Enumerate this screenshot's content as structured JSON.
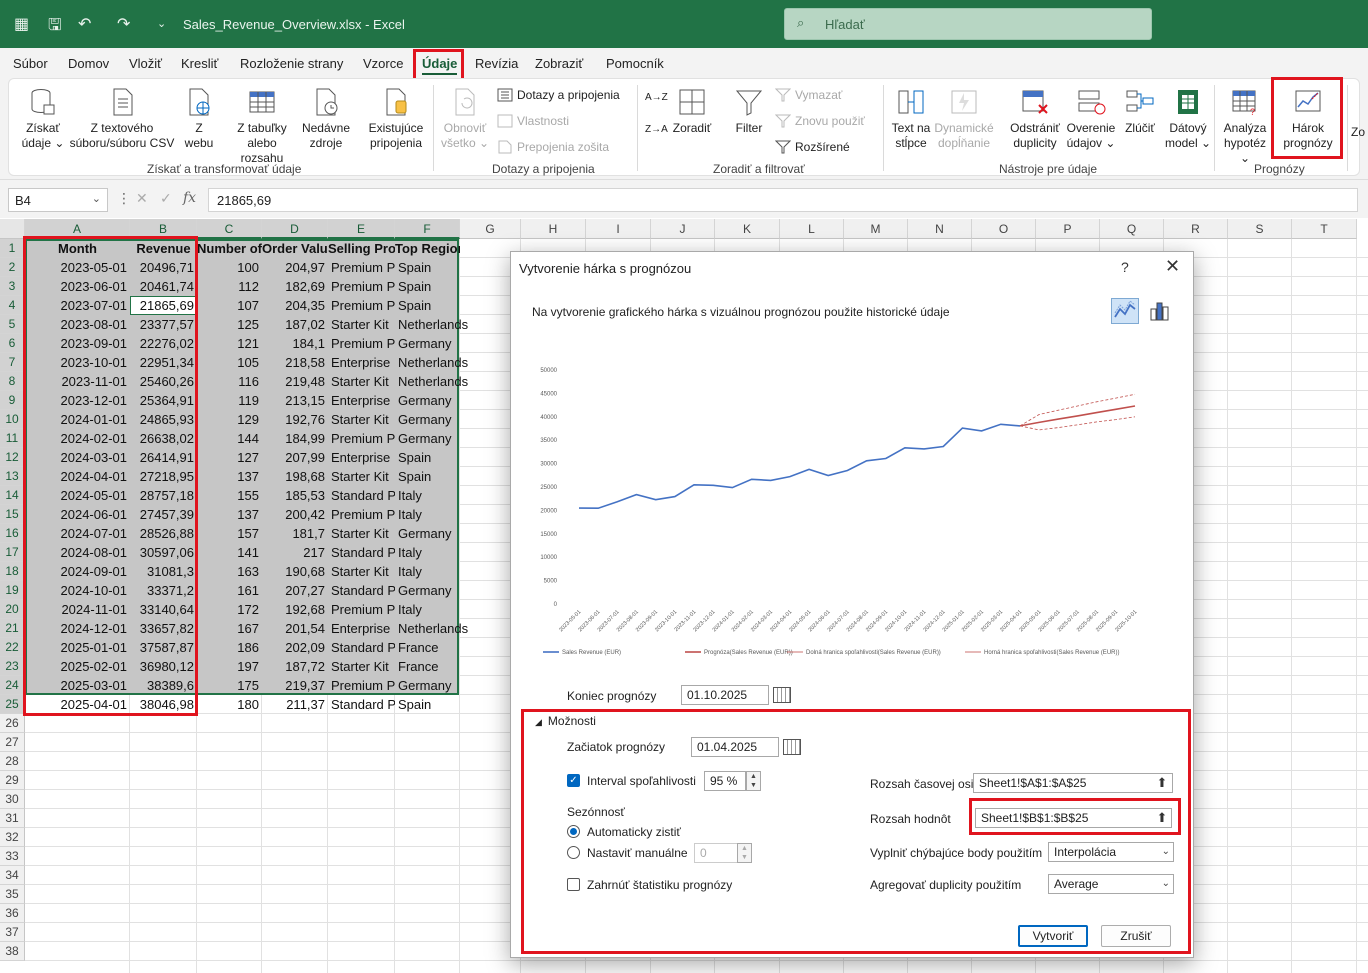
{
  "window": {
    "filename": "Sales_Revenue_Overview.xlsx",
    "separator": " - ",
    "app": "Excel",
    "search_placeholder": "Hľadať",
    "icons": [
      "excel-logo-icon",
      "save-icon",
      "undo-icon",
      "redo-icon",
      "customize-icon",
      "search-icon"
    ]
  },
  "menu": [
    "Súbor",
    "Domov",
    "Vložiť",
    "Kresliť",
    "Rozloženie strany",
    "Vzorce",
    "Údaje",
    "Revízia",
    "Zobraziť",
    "Pomocník"
  ],
  "ribbon": {
    "get_data": {
      "l1": "Získať",
      "l2": "údaje ⌄"
    },
    "text_csv": {
      "l1": "Z textového",
      "l2": "súboru/súboru CSV"
    },
    "web": {
      "l1": "Z",
      "l2": "webu"
    },
    "table_range": {
      "l1": "Z tabuľky",
      "l2": "alebo rozsahu"
    },
    "recent": {
      "l1": "Nedávne",
      "l2": "zdroje"
    },
    "existing": {
      "l1": "Existujúce",
      "l2": "pripojenia"
    },
    "group1": "Získať a transformovať údaje",
    "refresh": {
      "l1": "Obnoviť",
      "l2": "všetko ⌄"
    },
    "queries": "Dotazy a pripojenia",
    "properties": "Vlastnosti",
    "edit_links": "Prepojenia zošita",
    "group2": "Dotazy a pripojenia",
    "sort_az": "A→Z",
    "sort_za": "Z→A",
    "sort": "Zoradiť",
    "filter": "Filter",
    "clear": "Vymazať",
    "reapply": "Znovu použiť",
    "advanced": "Rozšírené",
    "group3": "Zoradiť a filtrovať",
    "text_columns": {
      "l1": "Text na",
      "l2": "stĺpce"
    },
    "flash_fill": {
      "l1": "Dynamické",
      "l2": "dopĺňanie"
    },
    "remove_dup": {
      "l1": "Odstrániť",
      "l2": "duplicity"
    },
    "validation": {
      "l1": "Overenie",
      "l2": "údajov ⌄"
    },
    "consolidate": {
      "l1": "Zlúčiť",
      "l2": ""
    },
    "data_model": {
      "l1": "Dátový",
      "l2": "model ⌄"
    },
    "group4": "Nástroje pre údaje",
    "whatif": {
      "l1": "Analýza",
      "l2": "hypotéz ⌄"
    },
    "forecast_sheet": {
      "l1": "Hárok",
      "l2": "prognózy"
    },
    "group5": "Prognózy",
    "cut_label": "Zo"
  },
  "formula": {
    "namebox": "B4",
    "namebox_arrow": "⌄",
    "more": "⋮",
    "cancel": "✕",
    "enter": "✓",
    "fx": "fx",
    "value": "21865,69"
  },
  "columns": [
    "A",
    "B",
    "C",
    "D",
    "E",
    "F",
    "G",
    "H",
    "I",
    "J",
    "K",
    "L",
    "M",
    "N",
    "O",
    "P",
    "Q",
    "R",
    "S",
    "T"
  ],
  "headers": [
    "Month",
    "Revenue",
    "Number of Orders",
    "Order Value",
    "Selling Product",
    "Top Region"
  ],
  "rows": [
    [
      "2023-05-01",
      "20496,71",
      "100",
      "204,97",
      "Premium P",
      "Spain"
    ],
    [
      "2023-06-01",
      "20461,74",
      "112",
      "182,69",
      "Premium P",
      "Spain"
    ],
    [
      "2023-07-01",
      "21865,69",
      "107",
      "204,35",
      "Premium P",
      "Spain"
    ],
    [
      "2023-08-01",
      "23377,57",
      "125",
      "187,02",
      "Starter Kit",
      "Netherlands"
    ],
    [
      "2023-09-01",
      "22276,02",
      "121",
      "184,1",
      "Premium P",
      "Germany"
    ],
    [
      "2023-10-01",
      "22951,34",
      "105",
      "218,58",
      "Enterprise",
      "Netherlands"
    ],
    [
      "2023-11-01",
      "25460,26",
      "116",
      "219,48",
      "Starter Kit",
      "Netherlands"
    ],
    [
      "2023-12-01",
      "25364,91",
      "119",
      "213,15",
      "Enterprise",
      "Germany"
    ],
    [
      "2024-01-01",
      "24865,93",
      "129",
      "192,76",
      "Starter Kit",
      "Germany"
    ],
    [
      "2024-02-01",
      "26638,02",
      "144",
      "184,99",
      "Premium P",
      "Germany"
    ],
    [
      "2024-03-01",
      "26414,91",
      "127",
      "207,99",
      "Enterprise",
      "Spain"
    ],
    [
      "2024-04-01",
      "27218,95",
      "137",
      "198,68",
      "Starter Kit",
      "Spain"
    ],
    [
      "2024-05-01",
      "28757,18",
      "155",
      "185,53",
      "Standard P",
      "Italy"
    ],
    [
      "2024-06-01",
      "27457,39",
      "137",
      "200,42",
      "Premium P",
      "Italy"
    ],
    [
      "2024-07-01",
      "28526,88",
      "157",
      "181,7",
      "Starter Kit",
      "Germany"
    ],
    [
      "2024-08-01",
      "30597,06",
      "141",
      "217",
      "Standard P",
      "Italy"
    ],
    [
      "2024-09-01",
      "31081,3",
      "163",
      "190,68",
      "Starter Kit",
      "Italy"
    ],
    [
      "2024-10-01",
      "33371,2",
      "161",
      "207,27",
      "Standard P",
      "Germany"
    ],
    [
      "2024-11-01",
      "33140,64",
      "172",
      "192,68",
      "Premium P",
      "Italy"
    ],
    [
      "2024-12-01",
      "33657,82",
      "167",
      "201,54",
      "Enterprise",
      "Netherlands"
    ],
    [
      "2025-01-01",
      "37587,87",
      "186",
      "202,09",
      "Standard P",
      "France"
    ],
    [
      "2025-02-01",
      "36980,12",
      "197",
      "187,72",
      "Starter Kit",
      "France"
    ],
    [
      "2025-03-01",
      "38389,6",
      "175",
      "219,37",
      "Premium P",
      "Germany"
    ],
    [
      "2025-04-01",
      "38046,98",
      "180",
      "211,37",
      "Standard P",
      "Spain"
    ]
  ],
  "row_numbers": [
    "1",
    "2",
    "3",
    "4",
    "5",
    "6",
    "7",
    "8",
    "9",
    "10",
    "11",
    "12",
    "13",
    "14",
    "15",
    "16",
    "17",
    "18",
    "19",
    "20",
    "21",
    "22",
    "23",
    "24",
    "25",
    "26",
    "27",
    "28",
    "29",
    "30",
    "31",
    "32",
    "33",
    "34",
    "35",
    "36",
    "37",
    "38"
  ],
  "dialog": {
    "title": "Vytvorenie hárka s prognózou",
    "help": "?",
    "close": "✕",
    "subtitle": "Na vytvorenie grafického hárka s vizuálnou prognózou použite historické údaje",
    "forecast_end_label": "Koniec prognózy",
    "forecast_end": "01.10.2025",
    "options_label": "Možnosti",
    "forecast_start_label": "Začiatok prognózy",
    "forecast_start": "01.04.2025",
    "confidence_label": "Interval spoľahlivosti",
    "confidence": "95 %",
    "seasonality_label": "Sezónnosť",
    "auto_detect": "Automaticky zistiť",
    "manual": "Nastaviť manuálne",
    "manual_value": "0",
    "include_stats": "Zahrnúť štatistiku prognózy",
    "timeline_label": "Rozsah časovej osi",
    "timeline": "Sheet1!$A$1:$A$25",
    "values_label": "Rozsah hodnôt",
    "values": "Sheet1!$B$1:$B$25",
    "fill_missing_label": "Vyplniť chýbajúce body použitím",
    "fill_missing": "Interpolácia",
    "aggregate_label": "Agregovať duplicity použitím",
    "aggregate": "Average",
    "create": "Vytvoriť",
    "cancel": "Zrušiť"
  },
  "chart_data": {
    "type": "line",
    "x": [
      "2023-05-01",
      "2023-06-01",
      "2023-07-01",
      "2023-08-01",
      "2023-09-01",
      "2023-10-01",
      "2023-11-01",
      "2023-12-01",
      "2024-01-01",
      "2024-02-01",
      "2024-03-01",
      "2024-04-01",
      "2024-05-01",
      "2024-06-01",
      "2024-07-01",
      "2024-08-01",
      "2024-09-01",
      "2024-10-01",
      "2024-11-01",
      "2024-12-01",
      "2025-01-01",
      "2025-02-01",
      "2025-03-01",
      "2025-04-01",
      "2025-05-01",
      "2025-06-01",
      "2025-07-01",
      "2025-08-01",
      "2025-09-01",
      "2025-10-01"
    ],
    "ylim": [
      0,
      50000
    ],
    "yticks": [
      "0",
      "5000",
      "10000",
      "15000",
      "20000",
      "25000",
      "30000",
      "35000",
      "40000",
      "45000",
      "50000"
    ],
    "series": [
      {
        "name": "Sales Revenue (EUR)",
        "color": "#4472c4",
        "values": [
          20496.71,
          20461.74,
          21865.69,
          23377.57,
          22276.02,
          22951.34,
          25460.26,
          25364.91,
          24865.93,
          26638.02,
          26414.91,
          27218.95,
          28757.18,
          27457.39,
          28526.88,
          30597.06,
          31081.3,
          33371.2,
          33140.64,
          33657.82,
          37587.87,
          36980.12,
          38389.6,
          38046.98,
          null,
          null,
          null,
          null,
          null,
          null
        ]
      },
      {
        "name": "Prognóza(Sales Revenue (EUR))",
        "color": "#c0504d",
        "values": [
          null,
          null,
          null,
          null,
          null,
          null,
          null,
          null,
          null,
          null,
          null,
          null,
          null,
          null,
          null,
          null,
          null,
          null,
          null,
          null,
          null,
          null,
          null,
          38046.98,
          38800,
          39500,
          40200,
          40900,
          41600,
          42300
        ]
      },
      {
        "name": "Dolná hranica spoľahlivosti(Sales Revenue (EUR))",
        "color": "#c0504d",
        "values": [
          null,
          null,
          null,
          null,
          null,
          null,
          null,
          null,
          null,
          null,
          null,
          null,
          null,
          null,
          null,
          null,
          null,
          null,
          null,
          null,
          null,
          null,
          null,
          38046.98,
          37200,
          37700,
          38300,
          38900,
          39400,
          40000
        ]
      },
      {
        "name": "Horná hranica spoľahlivosti(Sales Revenue (EUR))",
        "color": "#c0504d",
        "values": [
          null,
          null,
          null,
          null,
          null,
          null,
          null,
          null,
          null,
          null,
          null,
          null,
          null,
          null,
          null,
          null,
          null,
          null,
          null,
          null,
          null,
          null,
          null,
          38046.98,
          40500,
          41400,
          42300,
          43200,
          44000,
          44800
        ]
      }
    ]
  }
}
